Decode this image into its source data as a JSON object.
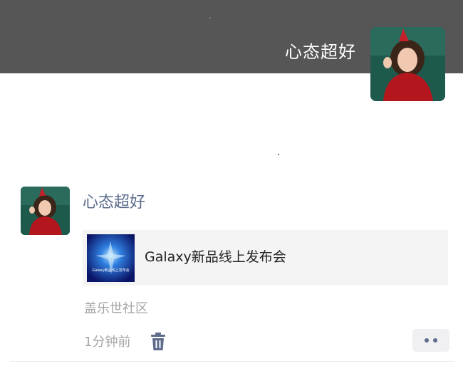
{
  "header": {
    "username": "心态超好",
    "avatar_icon": "user-avatar-photo"
  },
  "moment": {
    "username": "心态超好",
    "avatar_icon": "user-avatar-photo",
    "link": {
      "title": "Galaxy新品线上发布会",
      "thumb_caption": "Galaxy新品线上发布会",
      "thumb_icon": "blue-light-burst-image"
    },
    "source": "盖乐世社区",
    "time": "1分钟前",
    "delete_icon": "trash-icon",
    "more_icon": "more-dots-icon"
  },
  "colors": {
    "header_bg": "#565656",
    "name_link": "#5a6b8c",
    "card_bg": "#f4f4f4",
    "meta_text": "#a5a5a5"
  }
}
